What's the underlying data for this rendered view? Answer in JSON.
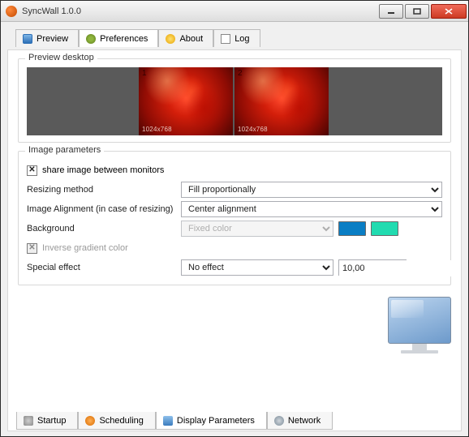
{
  "window": {
    "title": "SyncWall 1.0.0"
  },
  "tabs": {
    "preview": "Preview",
    "preferences": "Preferences",
    "about": "About",
    "log": "Log"
  },
  "preview_group": {
    "legend": "Preview  desktop",
    "monitors": [
      {
        "num": "1",
        "res": "1024x768"
      },
      {
        "num": "2",
        "res": "1024x768"
      }
    ]
  },
  "params_group": {
    "legend": "Image parameters",
    "share_label": "share image between monitors",
    "resize_label": "Resizing method",
    "resize_value": "Fill proportionally",
    "align_label": "Image Alignment (in case of resizing)",
    "align_value": "Center alignment",
    "bg_label": "Background",
    "bg_value": "Fixed color",
    "bg_color1": "#0a7ec4",
    "bg_color2": "#21dbb0",
    "inverse_label": "Inverse gradient color",
    "effect_label": "Special effect",
    "effect_value": "No effect",
    "effect_spin": "10,00"
  },
  "bottom_tabs": {
    "startup": "Startup",
    "scheduling": "Scheduling",
    "display": "Display Parameters",
    "network": "Network"
  }
}
